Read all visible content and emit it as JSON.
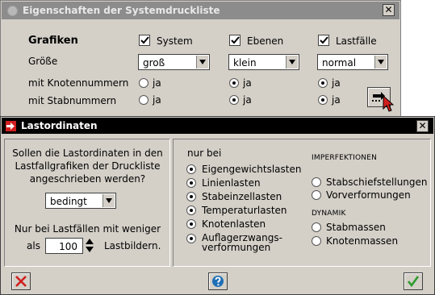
{
  "back_window": {
    "title": "Eigenschaften der Systemdruckliste",
    "close_glyph": "✕",
    "section_title": "Grafiken",
    "columns": [
      {
        "check_label": "System",
        "checked": true,
        "size": "groß",
        "knoten": false,
        "stab": false
      },
      {
        "check_label": "Ebenen",
        "checked": true,
        "size": "klein",
        "knoten": true,
        "stab": true
      },
      {
        "check_label": "Lastfälle",
        "checked": true,
        "size": "normal",
        "knoten": true,
        "stab": true
      }
    ],
    "row_size_label": "Größe",
    "row_knoten_label": "mit Knotennummern",
    "row_stab_label": "mit Stabnummern",
    "radio_label": "ja"
  },
  "dialog": {
    "title": "Lastordinaten",
    "close_glyph": "✕",
    "question_lines": [
      "Sollen die Lastordinaten in den",
      "Lastfallgrafiken der Druckliste",
      "angeschrieben werden?"
    ],
    "mode_value": "bedingt",
    "limit_line1": "Nur bei Lastfällen mit weniger",
    "limit_prefix": "als",
    "limit_value": "100",
    "limit_suffix": "Lastbildern.",
    "only_for_label": "nur bei",
    "load_types": [
      {
        "label": "Eigengewichtslasten",
        "on": true
      },
      {
        "label": "Linienlasten",
        "on": true
      },
      {
        "label": "Stabeinzellasten",
        "on": true
      },
      {
        "label": "Temperaturlasten",
        "on": true
      },
      {
        "label": "Knotenlasten",
        "on": true
      },
      {
        "label": "Auflagerzwangs-",
        "label2": "verformungen",
        "on": true
      }
    ],
    "imperfections_heading": "IMPERFEKTIONEN",
    "imperfections": [
      {
        "label": "Stabschiefstellungen",
        "on": false
      },
      {
        "label": "Vorverformungen",
        "on": false
      }
    ],
    "dynamics_heading": "DYNAMIK",
    "dynamics": [
      {
        "label": "Stabmassen",
        "on": false
      },
      {
        "label": "Knotenmassen",
        "on": false
      }
    ]
  },
  "colors": {
    "accent_red": "#d21e1e",
    "help_blue": "#1f6fb5",
    "ok_green": "#2e9b2e"
  }
}
